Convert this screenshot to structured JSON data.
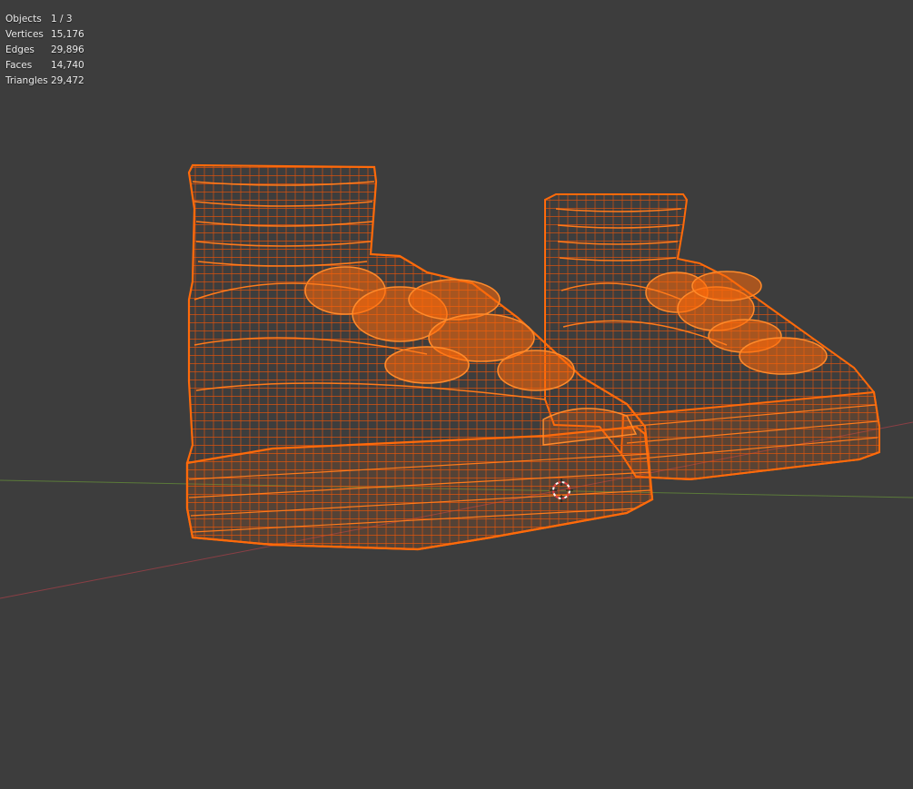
{
  "stats": {
    "objects": {
      "label": "Objects",
      "value": "1 / 3"
    },
    "vertices": {
      "label": "Vertices",
      "value": "15,176"
    },
    "edges": {
      "label": "Edges",
      "value": "29,896"
    },
    "faces": {
      "label": "Faces",
      "value": "14,740"
    },
    "triangles": {
      "label": "Triangles",
      "value": "29,472"
    }
  },
  "colors": {
    "background": "#3d3d3d",
    "wire_selected": "#ff6a0a",
    "x_axis": "#8a3f45",
    "y_axis": "#5b7a3a",
    "cursor_red": "#e04040"
  },
  "icons": {
    "cursor": "3d-cursor-icon"
  }
}
